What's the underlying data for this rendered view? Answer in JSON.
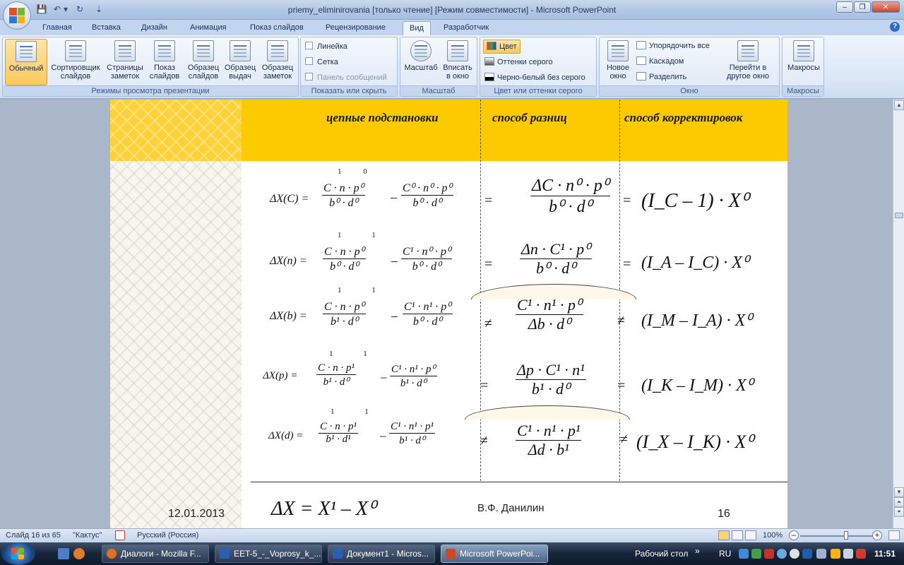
{
  "window": {
    "title": "priemy_eliminirovania [только чтение] [Режим совместимости] - Microsoft PowerPoint",
    "minimize": "–",
    "maximize": "❐",
    "close": "✕"
  },
  "qat": {
    "save": "💾",
    "undo": "↶",
    "undo_dropdown": "▾",
    "redo": "↻",
    "customize": "⇣"
  },
  "ribbon_tabs": [
    {
      "label": "Главная"
    },
    {
      "label": "Вставка"
    },
    {
      "label": "Дизайн"
    },
    {
      "label": "Анимация"
    },
    {
      "label": "Показ слайдов"
    },
    {
      "label": "Рецензирование"
    },
    {
      "label": "Вид",
      "active": true
    },
    {
      "label": "Разработчик"
    }
  ],
  "help": "?",
  "groups": {
    "views": {
      "label": "Режимы просмотра презентации",
      "buttons": [
        {
          "label": "Обычный",
          "active": true
        },
        {
          "label": "Сортировщик слайдов"
        },
        {
          "label": "Страницы заметок"
        },
        {
          "label": "Показ слайдов"
        },
        {
          "label": "Образец слайдов"
        },
        {
          "label": "Образец выдач"
        },
        {
          "label": "Образец заметок"
        }
      ]
    },
    "show_hide": {
      "label": "Показать или скрыть",
      "items": [
        {
          "label": "Линейка"
        },
        {
          "label": "Сетка"
        },
        {
          "label": "Панель сообщений",
          "disabled": true
        }
      ]
    },
    "zoom": {
      "label": "Масштаб",
      "buttons": [
        {
          "label": "Масштаб"
        },
        {
          "label": "Вписать в окно"
        }
      ]
    },
    "color": {
      "label": "Цвет или оттенки серого",
      "items": [
        {
          "label": "Цвет",
          "active": true
        },
        {
          "label": "Оттенки серого"
        },
        {
          "label": "Черно-белый без серого"
        }
      ]
    },
    "window": {
      "label": "Окно",
      "new_window": "Новое окно",
      "items": [
        {
          "label": "Упорядочить все"
        },
        {
          "label": "Каскадом"
        },
        {
          "label": "Разделить"
        }
      ],
      "switch": "Перейти в другое окно"
    },
    "macros": {
      "label": "Макросы",
      "button": "Макросы"
    }
  },
  "slide": {
    "headers": [
      "цепные подстановки",
      "способ разниц",
      "способ корректировок"
    ],
    "rows": [
      {
        "lhs": "ΔX(C) =",
        "sup_marks": "1 0",
        "frac1": {
          "num": "C · n · p⁰",
          "den": "b⁰ · d⁰"
        },
        "minus": "–",
        "frac2": {
          "num": "C⁰ · n⁰ · p⁰",
          "den": "b⁰ · d⁰"
        },
        "rel1": "=",
        "frac3": {
          "num": "ΔC · n⁰ · p⁰",
          "den": "b⁰ · d⁰"
        },
        "rel2": "=",
        "result": "(I_C – 1) · X⁰",
        "result_html": "(I<sub>C</sub> − 1) · X<sup>0</sup>"
      },
      {
        "lhs": "ΔX(n) =",
        "sup_marks": "1 1",
        "frac1": {
          "num": "C · n · p⁰",
          "den": "b⁰ · d⁰"
        },
        "minus": "–",
        "frac2": {
          "num": "C¹ · n⁰ · p⁰",
          "den": "b⁰ · d⁰"
        },
        "rel1": "=",
        "frac3": {
          "num": "Δn · C¹ · p⁰",
          "den": "b⁰ · d⁰"
        },
        "rel2": "=",
        "result": "(I_A – I_C) · X⁰"
      },
      {
        "lhs": "ΔX(b) =",
        "sup_marks": "1 1",
        "frac1": {
          "num": "C · n · p⁰",
          "den": "b¹ · d⁰"
        },
        "minus": "–",
        "frac2": {
          "num": "C¹ · n¹ · p⁰",
          "den": "b⁰ · d⁰"
        },
        "rel1": "≠",
        "frac3": {
          "num": "C¹ · n¹ · p⁰",
          "den": "Δb · d⁰"
        },
        "rel2": "≠",
        "result": "(I_M – I_A) · X⁰"
      },
      {
        "lhs": "ΔX(p) =",
        "sup_marks": "1 1",
        "frac1": {
          "num": "C · n · p¹",
          "den": "b¹ · d⁰"
        },
        "minus": "–",
        "frac2": {
          "num": "C¹ · n¹ · p⁰",
          "den": "b¹ · d⁰"
        },
        "rel1": "=",
        "frac3": {
          "num": "Δp · C¹ · n¹",
          "den": "b¹ · d⁰"
        },
        "rel2": "=",
        "result": "(I_K – I_M) · X⁰"
      },
      {
        "lhs": "ΔX(d) =",
        "sup_marks": "1 1",
        "frac1": {
          "num": "C · n · p¹",
          "den": "b¹ · d¹"
        },
        "minus": "–",
        "frac2": {
          "num": "C¹ · n¹ · p¹",
          "den": "b¹ · d⁰"
        },
        "rel1": "≠",
        "frac3": {
          "num": "C¹ · n¹ · p¹",
          "den": "Δd · b¹"
        },
        "rel2": "≠",
        "result": "(I_X – I_K) · X⁰"
      }
    ],
    "bottom_formula": "ΔX = X¹ – X⁰",
    "footer_date": "12.01.2013",
    "footer_author": "В.Ф. Данилин",
    "footer_page": "16"
  },
  "status": {
    "slide": "Слайд 16 из 65",
    "theme": "\"Кактус\"",
    "language": "Русский (Россия)",
    "zoom": "100%",
    "zoom_level_percent": 100,
    "zoom_minus": "–",
    "zoom_plus": "+"
  },
  "taskbar": {
    "tasks": [
      {
        "label": "Диалоги - Mozilla F...",
        "icon_color": "#e2711d"
      },
      {
        "label": "EET-5_-_Voprosy_k_...",
        "icon_color": "#2b5fb4"
      },
      {
        "label": "Документ1 - Micros...",
        "icon_color": "#2b5fb4"
      },
      {
        "label": "Microsoft PowerPoi...",
        "icon_color": "#d2481c",
        "active": true
      }
    ],
    "desktop": "Рабочий стол",
    "desktop_arrows": "»",
    "lang": "RU",
    "clock": "11:51"
  }
}
